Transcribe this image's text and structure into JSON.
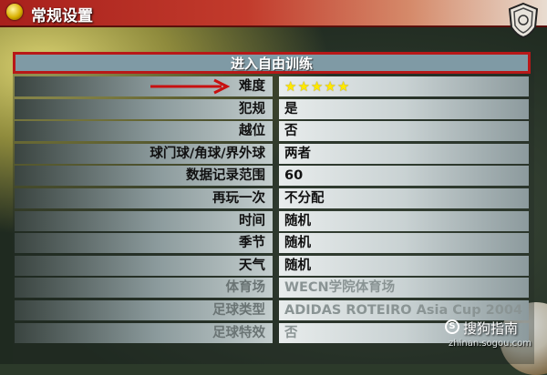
{
  "window": {
    "title": "常规设置"
  },
  "header": {
    "label": "进入自由训练"
  },
  "rows": [
    {
      "label": "难度",
      "value": "",
      "stars": 5,
      "dim": false
    },
    {
      "label": "犯规",
      "value": "是",
      "dim": false
    },
    {
      "label": "越位",
      "value": "否",
      "dim": false
    },
    {
      "label": "球门球/角球/界外球",
      "value": "两者",
      "dim": false
    },
    {
      "label": "数据记录范围",
      "value": "60",
      "dim": false
    },
    {
      "label": "再玩一次",
      "value": "不分配",
      "dim": false
    },
    {
      "label": "时间",
      "value": "随机",
      "dim": false
    },
    {
      "label": "季节",
      "value": "随机",
      "dim": false
    },
    {
      "label": "天气",
      "value": "随机",
      "dim": false
    },
    {
      "label": "体育场",
      "value": "WECN学院体育场",
      "dim": true
    },
    {
      "label": "足球类型",
      "value": "ADIDAS ROTEIRO  Asia Cup 2004",
      "dim": true
    },
    {
      "label": "足球特效",
      "value": "否",
      "dim": true
    }
  ],
  "watermark": {
    "main": "搜狗指南",
    "sub": "zhinan.sogou.com"
  },
  "colors": {
    "accent_red": "#b81818",
    "header_bg": "#7f9aa5",
    "star": "#ffe800"
  }
}
